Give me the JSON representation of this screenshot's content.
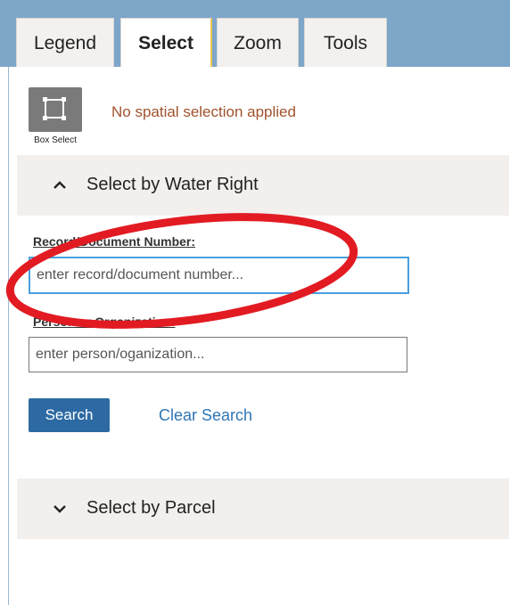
{
  "tabs": [
    {
      "label": "Legend",
      "active": false
    },
    {
      "label": "Select",
      "active": true
    },
    {
      "label": "Zoom",
      "active": false
    },
    {
      "label": "Tools",
      "active": false
    }
  ],
  "spatial_selection": {
    "tool_icon": "box-select-icon",
    "tool_label": "Box Select",
    "status": "No spatial selection applied"
  },
  "select_by_water_right": {
    "title": "Select by Water Right",
    "expanded": true,
    "icon": "chevron-up-icon",
    "record_label": "Record/Document Number:",
    "record_placeholder": "enter record/document number...",
    "person_label": "Person or Organization:",
    "person_placeholder": "enter person/oganization...",
    "search_label": "Search",
    "clear_label": "Clear Search"
  },
  "select_by_parcel": {
    "title": "Select by Parcel",
    "expanded": false,
    "icon": "chevron-down-icon"
  },
  "colors": {
    "header_blue": "#7ea6c9",
    "status_text": "#a0522d",
    "search_button": "#2d6aa3",
    "link": "#2f75b5",
    "focus_border": "#4a9fe0",
    "annotation_red": "#e21b23"
  }
}
